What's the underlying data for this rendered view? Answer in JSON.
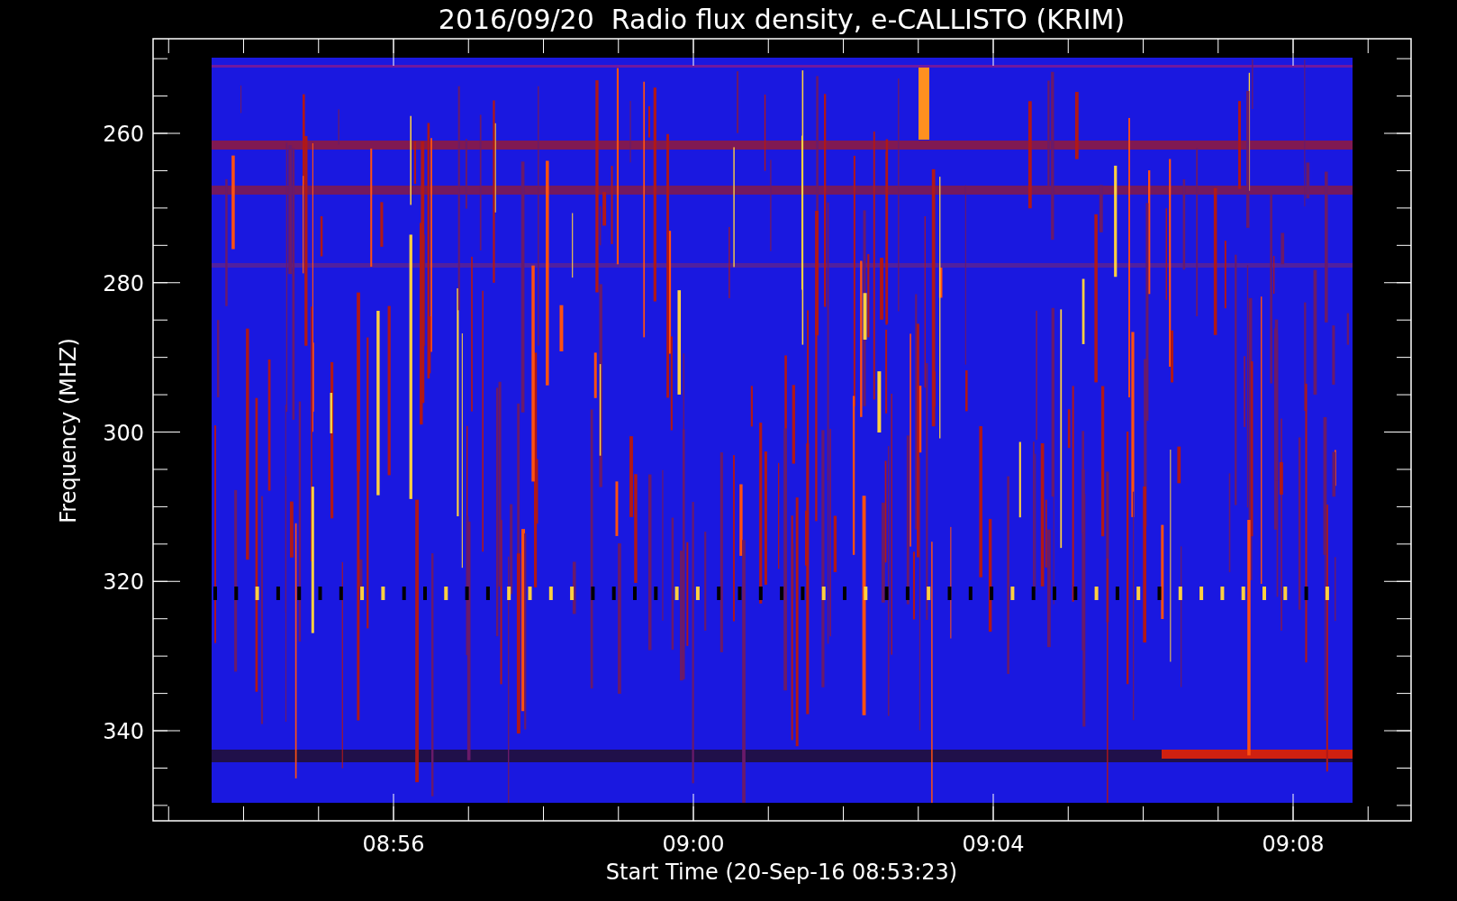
{
  "title": "2016/09/20  Radio flux density, e-CALLISTO (KRIM)",
  "ylabel": "Frequency (MHZ)",
  "xlabel": "Start Time (20-Sep-16 08:53:23)",
  "yticks": [
    "260",
    "280",
    "300",
    "320",
    "340"
  ],
  "xticks": [
    "08:56",
    "09:00",
    "09:04",
    "09:08"
  ]
}
